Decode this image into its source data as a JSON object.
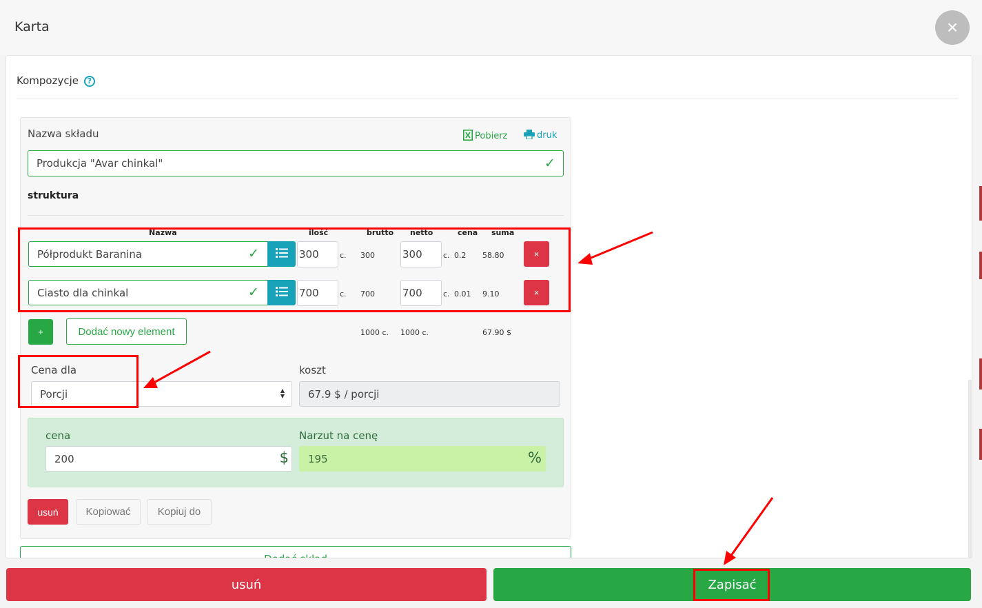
{
  "header": {
    "title": "Karta",
    "close_symbol": "×"
  },
  "section": {
    "title": "Kompozycje",
    "help_symbol": "?"
  },
  "card": {
    "name_label": "Nazwa składu",
    "download_label": "Pobierz",
    "print_label": "druk",
    "name_value": "Produkcja \"Avar chinkal\"",
    "structure_label": "struktura",
    "columns": {
      "name": "Nazwa",
      "qty": "ilość",
      "gross": "brutto",
      "net": "netto",
      "price": "cena",
      "sum": "suma"
    },
    "items": [
      {
        "name": "Półprodukt Baranina",
        "qty": "300",
        "qty_unit": "c.",
        "gross": "300",
        "net": "300",
        "net_unit": "c.",
        "price": "0.2",
        "sum": "58.80"
      },
      {
        "name": "Ciasto dla chinkal",
        "qty": "700",
        "qty_unit": "c.",
        "gross": "700",
        "net": "700",
        "net_unit": "c.",
        "price": "0.01",
        "sum": "9.10"
      }
    ],
    "delete_symbol": "×",
    "add_symbol": "+",
    "add_element_label": "Dodać nowy element",
    "totals": {
      "gross": "1000 c.",
      "net": "1000 c.",
      "sum": "67.90 $"
    },
    "price_for_label": "Cena dla",
    "price_for_value": "Porcji",
    "cost_label": "koszt",
    "cost_value": "67.9 $ / porcji",
    "price_label": "cena",
    "price_value": "200",
    "price_currency": "$",
    "markup_label": "Narzut na cenę",
    "markup_value": "195",
    "markup_unit": "%",
    "remove_label": "usuń",
    "copy_label": "Kopiować",
    "copy_to_label": "Kopiuj do"
  },
  "add_composition_label": "Dodać skład",
  "footer": {
    "delete_label": "usuń",
    "save_label": "Zapisać"
  },
  "colors": {
    "danger": "#dc3545",
    "success": "#28a745",
    "info": "#17a2b8",
    "annotation": "#ff0000"
  }
}
